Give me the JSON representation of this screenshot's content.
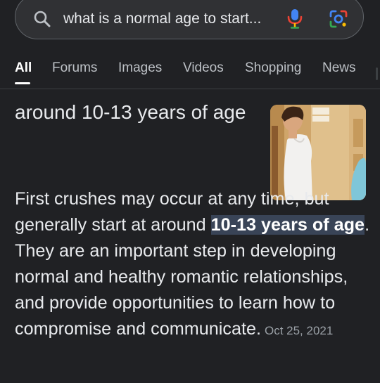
{
  "search": {
    "query": "what is a normal age to start..."
  },
  "tabs": [
    {
      "label": "All",
      "active": true
    },
    {
      "label": "Forums"
    },
    {
      "label": "Images"
    },
    {
      "label": "Videos"
    },
    {
      "label": "Shopping"
    },
    {
      "label": "News"
    }
  ],
  "answer": {
    "headline": "around 10-13 years of age"
  },
  "snippet": {
    "before": "First crushes may occur at any time, but generally start at around ",
    "highlight": "10-13 years of age",
    "after": ". They are an important step in developing normal and healthy romantic relationships, and provide opportunities to learn how to compromise and communicate.",
    "date": "Oct 25, 2021"
  },
  "icons": {
    "search": "search-icon",
    "mic": "microphone-icon",
    "lens": "google-lens-icon"
  },
  "colors": {
    "background": "#202124",
    "highlight": "#394457",
    "google_blue": "#4285f4",
    "google_red": "#ea4335",
    "google_yellow": "#fbbc04",
    "google_green": "#34a853"
  }
}
